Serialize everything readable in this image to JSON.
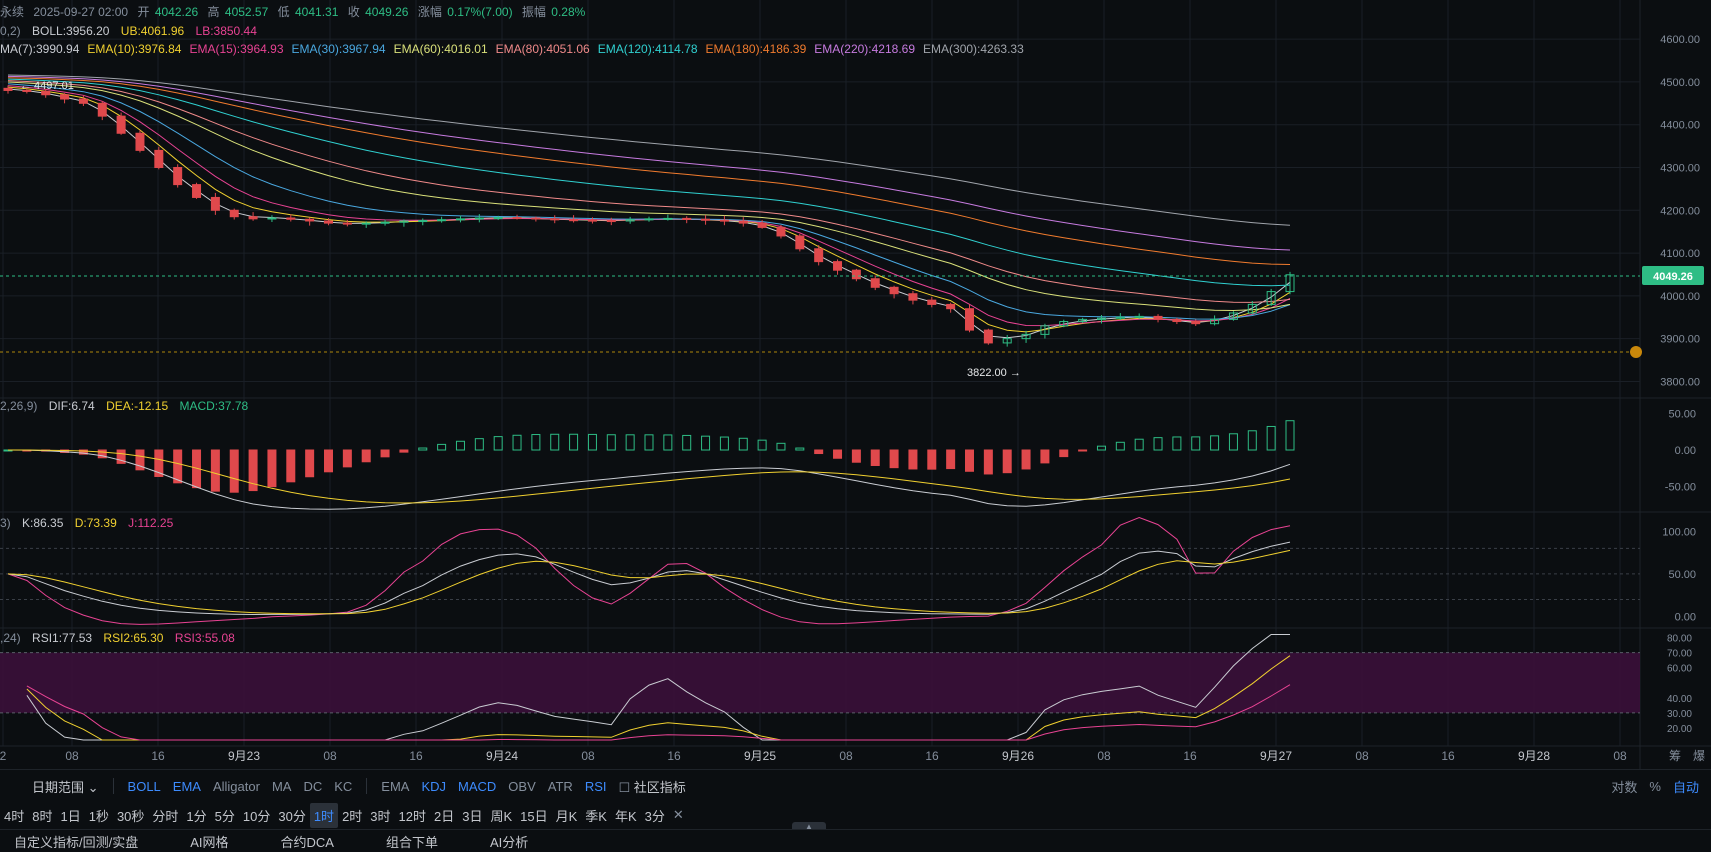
{
  "header": {
    "symbol": "永续",
    "datetime": "2025-09-27 02:00",
    "open_label": "开",
    "open": "4042.26",
    "high_label": "高",
    "high": "4052.57",
    "low_label": "低",
    "low": "4041.31",
    "close_label": "收",
    "close": "4049.26",
    "change_label": "涨幅",
    "change": "0.17%(7.00)",
    "amplitude_label": "振幅",
    "amplitude": "0.28%"
  },
  "boll_legend": {
    "prefix": "0,2)",
    "boll": "BOLL:3956.20",
    "ub": "UB:4061.96",
    "lb": "LB:3850.44"
  },
  "ema_legend": [
    {
      "text": "MA(7):3990.94",
      "color": "#c9ccd2"
    },
    {
      "text": "EMA(10):3976.84",
      "color": "#f0d030"
    },
    {
      "text": "EMA(15):3964.93",
      "color": "#e84393"
    },
    {
      "text": "EMA(30):3967.94",
      "color": "#4aa8e0"
    },
    {
      "text": "EMA(60):4016.01",
      "color": "#d9e07a"
    },
    {
      "text": "EMA(80):4051.06",
      "color": "#f08a8a"
    },
    {
      "text": "EMA(120):4114.78",
      "color": "#30d0d0"
    },
    {
      "text": "EMA(180):4186.39",
      "color": "#f07b2e"
    },
    {
      "text": "EMA(220):4218.69",
      "color": "#c77be0"
    },
    {
      "text": "EMA(300):4263.33",
      "color": "#a0a4ab"
    }
  ],
  "macd_legend": {
    "prefix": "2,26,9)",
    "dif": "DIF:6.74",
    "dea": "DEA:-12.15",
    "macd": "MACD:37.78"
  },
  "kdj_legend": {
    "prefix": "3)",
    "k": "K:86.35",
    "d": "D:73.39",
    "j": "J:112.25"
  },
  "rsi_legend": {
    "prefix": ",24)",
    "rsi1": "RSI1:77.53",
    "rsi2": "RSI2:65.30",
    "rsi3": "RSI3:55.08"
  },
  "annotations": {
    "high_marker": "← 4497.01",
    "low_marker": "3822.00 →"
  },
  "price_axis": {
    "ticks": [
      "4600.00",
      "4500.00",
      "4400.00",
      "4300.00",
      "4200.00",
      "4100.00",
      "4000.00",
      "3900.00",
      "3800.00"
    ],
    "current": "4049.26"
  },
  "macd_axis": [
    "50.00",
    "0.00",
    "-50.00"
  ],
  "kdj_axis": [
    "100.00",
    "50.00",
    "0.00"
  ],
  "rsi_axis": [
    "80.00",
    "70.00",
    "60.00",
    "40.00",
    "30.00",
    "20.00"
  ],
  "time_axis": [
    "2",
    "08",
    "16",
    "9月23",
    "08",
    "16",
    "9月24",
    "08",
    "16",
    "9月25",
    "08",
    "16",
    "9月26",
    "08",
    "16",
    "9月27",
    "08",
    "16",
    "9月28",
    "08"
  ],
  "axis_corner": [
    "筹",
    "爆"
  ],
  "toolbar1": {
    "date_range": "日期范围",
    "main_indicators": [
      "BOLL",
      "EMA",
      "Alligator",
      "MA",
      "DC",
      "KC"
    ],
    "sub_indicators": [
      "EMA",
      "KDJ",
      "MACD",
      "OBV",
      "ATR",
      "RSI"
    ],
    "community": "社区指标",
    "right": [
      "对数",
      "%",
      "自动"
    ]
  },
  "toolbar2": {
    "intervals": [
      "4时",
      "8时",
      "1日",
      "1秒",
      "30秒",
      "分时",
      "1分",
      "5分",
      "10分",
      "30分",
      "1时",
      "2时",
      "3时",
      "12时",
      "2日",
      "3日",
      "周K",
      "15日",
      "月K",
      "季K",
      "年K",
      "3分"
    ],
    "active": "1时",
    "close": "✕"
  },
  "toolbar3": {
    "tabs": [
      "自定义指标/回测/实盘",
      "AI网格",
      "合约DCA",
      "组合下单",
      "AI分析"
    ]
  },
  "colors": {
    "up": "#2ebd85",
    "down": "#e0494c",
    "bg": "#0b0e11",
    "grid": "#1a1f26",
    "accent": "#3d8bfd"
  },
  "chart_data": {
    "type": "candlestick",
    "interval": "1时",
    "ohlc_sample": {
      "close_path": [
        4480,
        4478,
        4470,
        4460,
        4450,
        4420,
        4380,
        4340,
        4300,
        4260,
        4230,
        4200,
        4185,
        4180,
        4182,
        4179,
        4175,
        4170,
        4168,
        4170,
        4172,
        4175,
        4176,
        4178,
        4180,
        4182,
        4183,
        4182,
        4180,
        4178,
        4177,
        4176,
        4175,
        4178,
        4180,
        4181,
        4179,
        4177,
        4175,
        4170,
        4160,
        4140,
        4110,
        4080,
        4060,
        4040,
        4020,
        4005,
        3990,
        3980,
        3970,
        3920,
        3890,
        3900,
        3910,
        3930,
        3940,
        3945,
        3948,
        3950,
        3952,
        3945,
        3940,
        3935,
        3945,
        3960,
        3980,
        4010,
        4049.26
      ],
      "high_annotation": 4497.01,
      "low_annotation": 3822.0
    },
    "price_range": [
      3780,
      4640
    ],
    "macd_range": [
      -75,
      75
    ],
    "kdj_range": [
      -10,
      125
    ],
    "rsi_range": [
      10,
      85
    ]
  }
}
